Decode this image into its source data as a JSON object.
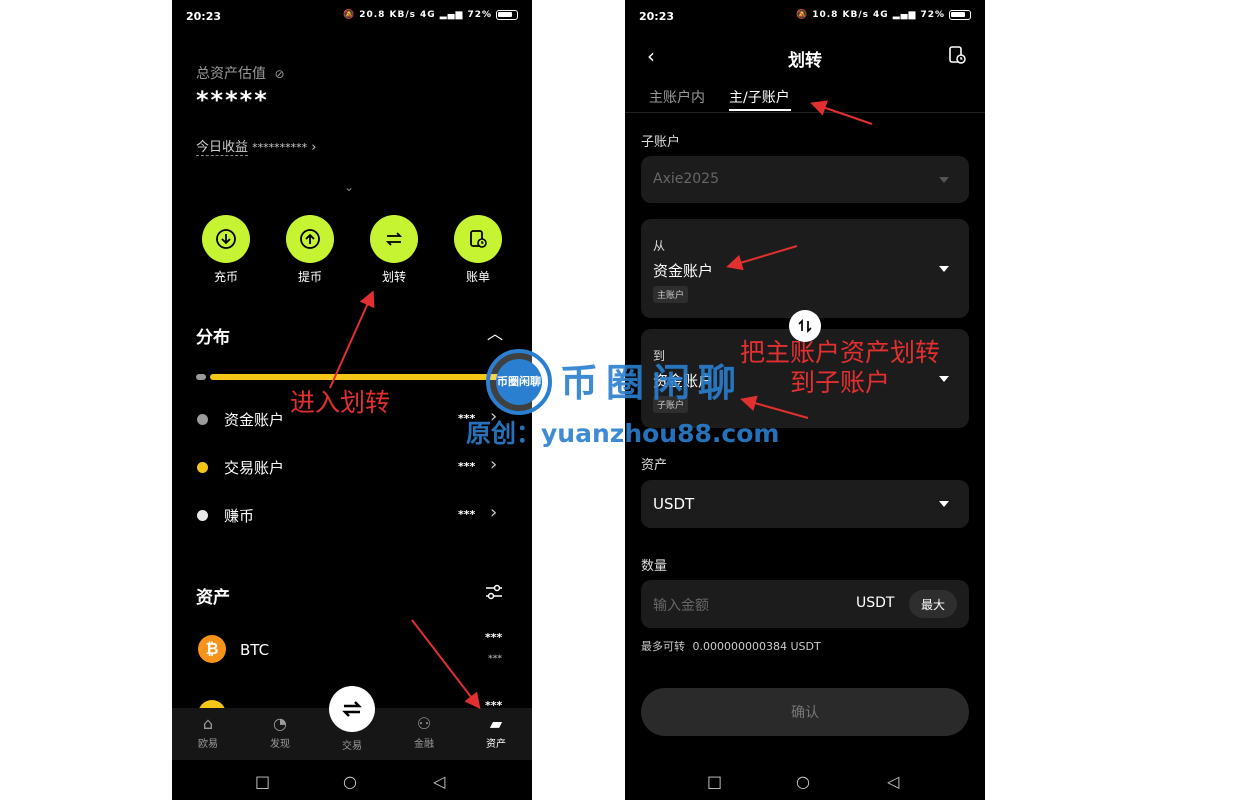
{
  "status": {
    "time": "20:23",
    "left_speed": "20.8 KB/s",
    "right_speed": "10.8 KB/s",
    "battery": "72%",
    "network": "4G"
  },
  "left": {
    "total_assets_label": "总资产估值",
    "total_assets_value": "*****",
    "today_earnings_label": "今日收益",
    "today_earnings_value": "**********",
    "actions": [
      "充币",
      "提币",
      "划转",
      "账单"
    ],
    "distribution_title": "分布",
    "distribution_rows": [
      {
        "label": "资金账户",
        "value": "***",
        "color": "#9a9a9a"
      },
      {
        "label": "交易账户",
        "value": "***",
        "color": "#f5c518"
      },
      {
        "label": "赚币",
        "value": "***",
        "color": "#e8e8e8"
      }
    ],
    "assets_title": "资产",
    "asset_rows": [
      {
        "symbol": "BTC",
        "value": "***",
        "sub_value": "***",
        "icon_color": "#f7931a"
      }
    ],
    "partial_value": "***",
    "tabs": [
      "欧易",
      "发现",
      "交易",
      "金融",
      "资产"
    ],
    "active_tab": "资产"
  },
  "right": {
    "title": "划转",
    "tabs": [
      "主账户内",
      "主/子账户"
    ],
    "active_tab": "主/子账户",
    "subaccount_label": "子账户",
    "subaccount_value": "Axie2025",
    "from_label": "从",
    "from_value": "资金账户",
    "from_tag": "主账户",
    "to_label": "到",
    "to_value": "资金账户",
    "to_tag": "子账户",
    "asset_label": "资产",
    "asset_value": "USDT",
    "amount_label": "数量",
    "amount_placeholder": "输入金额",
    "amount_unit": "USDT",
    "max_button": "最大",
    "max_transfer_label": "最多可转",
    "max_transfer_value": "0.000000000384 USDT",
    "confirm_button": "确认"
  },
  "annotations": {
    "enter_transfer": "进入划转",
    "transfer_note_line1": "把主账户资产划转",
    "transfer_note_line2": "到子账户",
    "annotation_color": "#e23030"
  },
  "watermark": {
    "badge": "币圈闲聊",
    "title": "币圈闲聊",
    "url": "原创：yuanzhou88.com",
    "color": "#2a7fd0"
  },
  "colors": {
    "accent": "#c6f432",
    "bg": "#000000",
    "field_bg": "#1c1c1c"
  }
}
